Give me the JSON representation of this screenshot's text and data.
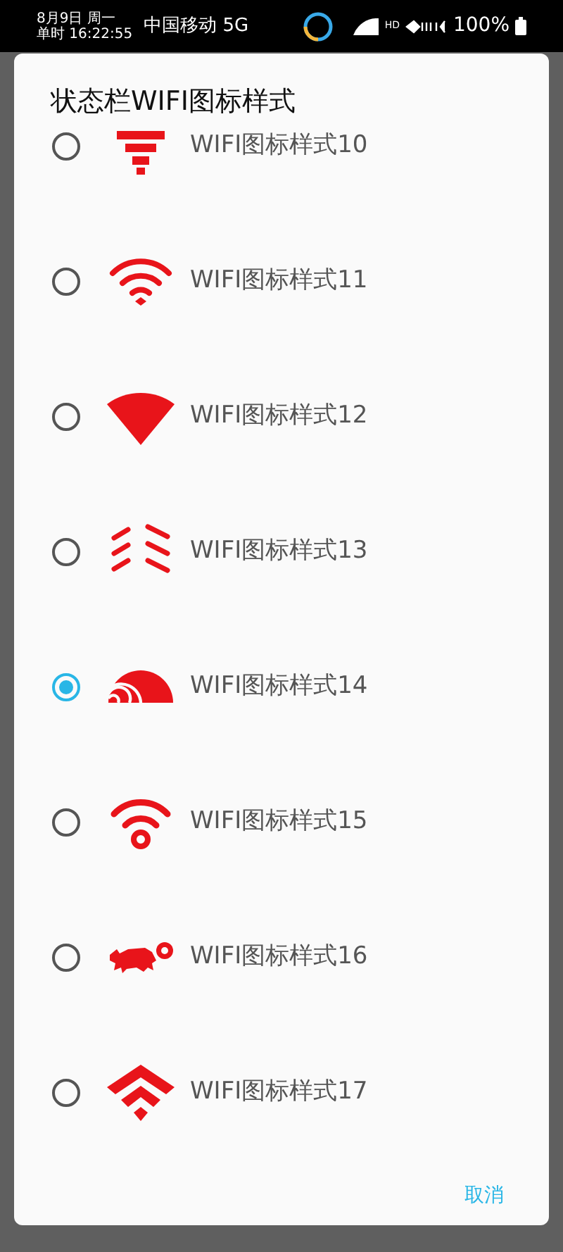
{
  "status_bar": {
    "date": "8月9日 周一",
    "time": "单时 16:22:55",
    "carrier": "中国移动 5G",
    "hd": "HD",
    "battery": "100%"
  },
  "dialog": {
    "title": "状态栏WIFI图标样式",
    "options": [
      {
        "label": "WIFI图标样式10",
        "selected": false
      },
      {
        "label": "WIFI图标样式11",
        "selected": false
      },
      {
        "label": "WIFI图标样式12",
        "selected": false
      },
      {
        "label": "WIFI图标样式13",
        "selected": false
      },
      {
        "label": "WIFI图标样式14",
        "selected": true
      },
      {
        "label": "WIFI图标样式15",
        "selected": false
      },
      {
        "label": "WIFI图标样式16",
        "selected": false
      },
      {
        "label": "WIFI图标样式17",
        "selected": false
      }
    ],
    "cancel": "取消"
  }
}
